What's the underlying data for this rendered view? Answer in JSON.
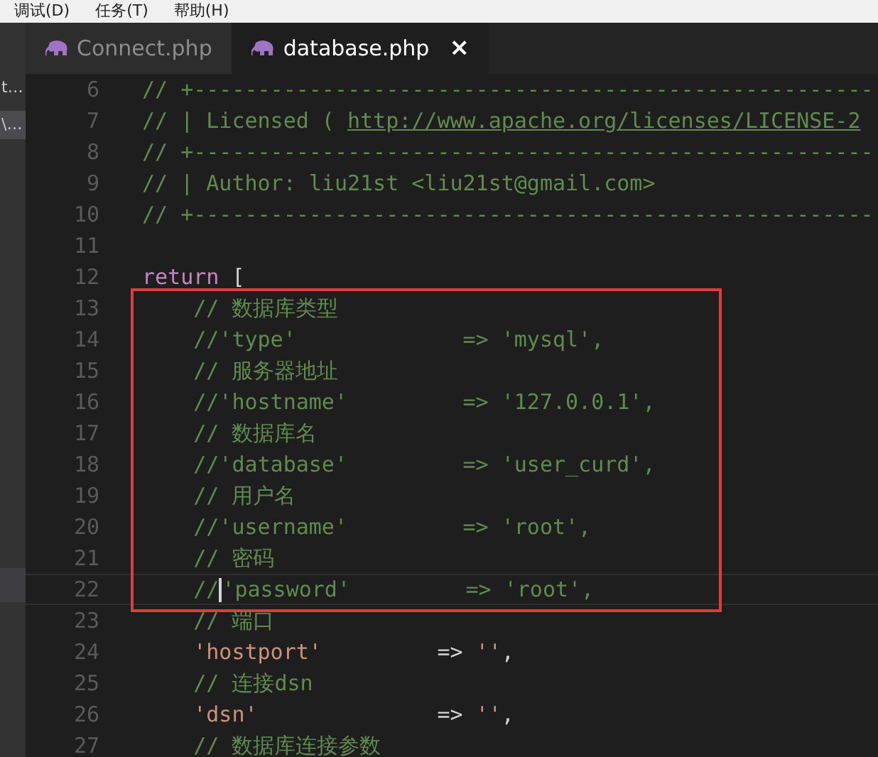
{
  "menu_bar": {
    "items": [
      "调试(D)",
      "任务(T)",
      "帮助(H)"
    ]
  },
  "sidebar": {
    "items": [
      {
        "label": "t…",
        "selected": false
      },
      {
        "label": "\\…",
        "selected": true
      }
    ]
  },
  "tabs": [
    {
      "label": "Connect.php",
      "selected": false
    },
    {
      "label": "database.php",
      "selected": true,
      "close": "×"
    }
  ],
  "editor": {
    "blocks": [
      {
        "boxed": false,
        "lines": [
          {
            "number": "6",
            "tokens": [
              {
                "kind": "comment",
                "text": "// +-----------------------------------------------------"
              }
            ]
          },
          {
            "number": "7",
            "tokens": [
              {
                "kind": "comment",
                "text": "// | Licensed ( "
              },
              {
                "kind": "link",
                "text": "http://www.apache.org/licenses/LICENSE-2"
              }
            ]
          },
          {
            "number": "8",
            "tokens": [
              {
                "kind": "comment",
                "text": "// +-----------------------------------------------------"
              }
            ]
          },
          {
            "number": "9",
            "tokens": [
              {
                "kind": "comment",
                "text": "// | Author: liu21st <liu21st@gmail.com>"
              }
            ]
          },
          {
            "number": "10",
            "tokens": [
              {
                "kind": "comment",
                "text": "// +-----------------------------------------------------"
              }
            ]
          },
          {
            "number": "11"
          },
          {
            "number": "12",
            "tokens": [
              {
                "kind": "keyword",
                "text": "return"
              },
              {
                "kind": "punct",
                "text": " ["
              }
            ]
          }
        ]
      },
      {
        "boxed": true,
        "lines": [
          {
            "number": "13",
            "tokens": [
              {
                "kind": "comment",
                "text": "    // 数据库类型"
              }
            ]
          },
          {
            "number": "14",
            "tokens": [
              {
                "kind": "comment",
                "text": "    //'type'             => 'mysql',"
              }
            ]
          },
          {
            "number": "15",
            "tokens": [
              {
                "kind": "comment",
                "text": "    // 服务器地址"
              }
            ]
          },
          {
            "number": "16",
            "tokens": [
              {
                "kind": "comment",
                "text": "    //'hostname'         => '127.0.0.1',"
              }
            ]
          },
          {
            "number": "17",
            "tokens": [
              {
                "kind": "comment",
                "text": "    // 数据库名"
              }
            ]
          },
          {
            "number": "18",
            "tokens": [
              {
                "kind": "comment",
                "text": "    //'database'         => 'user_curd',"
              }
            ]
          },
          {
            "number": "19",
            "tokens": [
              {
                "kind": "comment",
                "text": "    // 用户名"
              }
            ]
          },
          {
            "number": "20",
            "tokens": [
              {
                "kind": "comment",
                "text": "    //'username'         => 'root',"
              }
            ]
          },
          {
            "number": "21",
            "tokens": [
              {
                "kind": "comment",
                "text": "    // 密码"
              }
            ]
          },
          {
            "number": "22",
            "current": true,
            "tokens": [
              {
                "kind": "comment",
                "text": "    //"
              },
              {
                "kind": "cursor"
              },
              {
                "kind": "comment",
                "text": "'password'         => 'root',"
              }
            ]
          }
        ]
      },
      {
        "boxed": false,
        "lines": [
          {
            "number": "23",
            "tokens": [
              {
                "kind": "comment",
                "text": "    // 端口"
              }
            ]
          },
          {
            "number": "24",
            "tokens": [
              {
                "kind": "string",
                "text": "    'hostport'"
              },
              {
                "kind": "punct",
                "text": "         => "
              },
              {
                "kind": "string",
                "text": "''"
              },
              {
                "kind": "punct",
                "text": ","
              }
            ]
          },
          {
            "number": "25",
            "tokens": [
              {
                "kind": "comment",
                "text": "    // 连接dsn"
              }
            ]
          },
          {
            "number": "26",
            "tokens": [
              {
                "kind": "string",
                "text": "    'dsn'"
              },
              {
                "kind": "punct",
                "text": "              => "
              },
              {
                "kind": "string",
                "text": "''"
              },
              {
                "kind": "punct",
                "text": ","
              }
            ]
          },
          {
            "number": "27",
            "tokens": [
              {
                "kind": "comment",
                "text": "    // 数据库连接参数"
              }
            ]
          }
        ]
      }
    ]
  }
}
